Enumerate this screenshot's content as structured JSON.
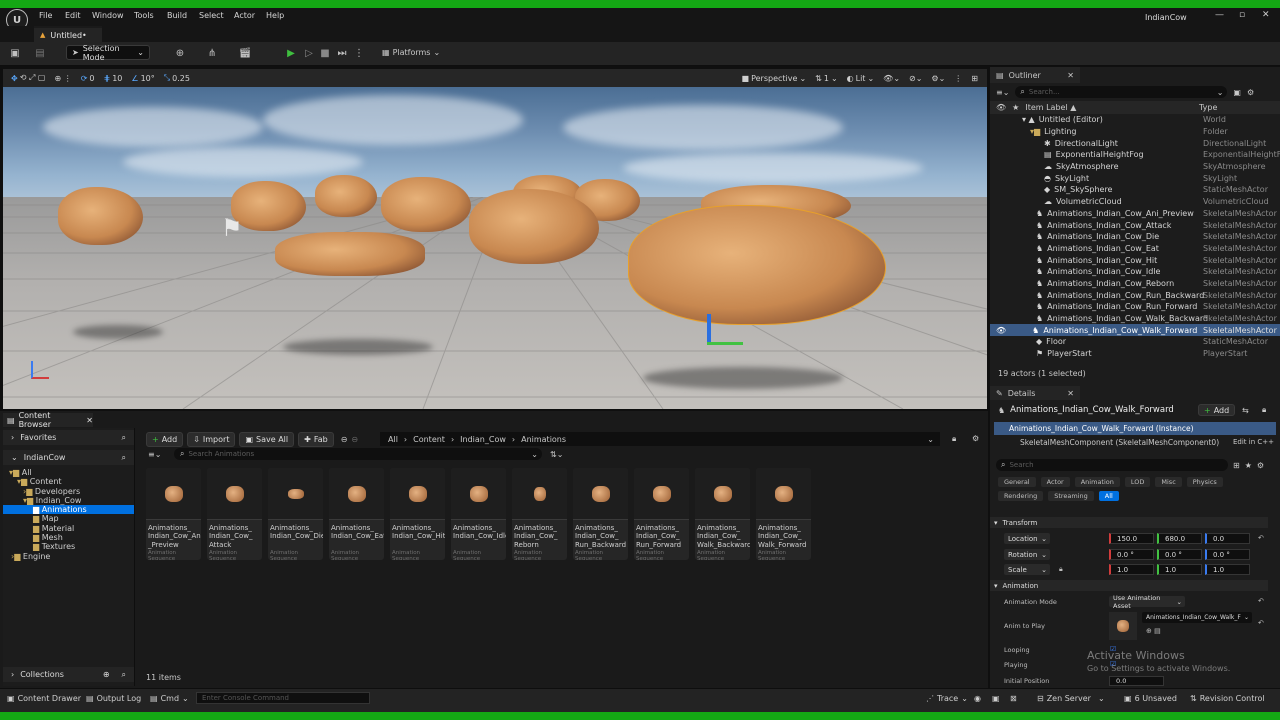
{
  "window": {
    "title": "IndianCow",
    "doc_tab": "Untitled•"
  },
  "menu": [
    "File",
    "Edit",
    "Window",
    "Tools",
    "Build",
    "Select",
    "Actor",
    "Help"
  ],
  "toolbar": {
    "selection_mode": "Selection Mode",
    "platforms": "Platforms"
  },
  "viewport": {
    "grid_snap": "10",
    "rot_snap": "10°",
    "scale_snap": "0.25",
    "rot_value": "0",
    "perspective": "Perspective",
    "lit": "Lit",
    "layer": "1"
  },
  "content_browser": {
    "tab": "Content Browser",
    "favorites": "Favorites",
    "project": "IndianCow",
    "tree": [
      "All",
      "Content",
      "Developers",
      "Indian_Cow",
      "Animations",
      "Map",
      "Material",
      "Mesh",
      "Textures",
      "Engine"
    ],
    "collections": "Collections",
    "add": "Add",
    "import": "Import",
    "save_all": "Save All",
    "fab": "Fab",
    "breadcrumb": [
      "All",
      "Content",
      "Indian_Cow",
      "Animations"
    ],
    "search_placeholder": "Search Animations",
    "item_count": "11 items",
    "assets": [
      {
        "name": "Animations_ Indian_Cow_Ani _Preview",
        "type": "Animation Sequence"
      },
      {
        "name": "Animations_ Indian_Cow_ Attack",
        "type": "Animation Sequence"
      },
      {
        "name": "Animations_ Indian_Cow_Die",
        "type": "Animation Sequence"
      },
      {
        "name": "Animations_ Indian_Cow_Eat",
        "type": "Animation Sequence"
      },
      {
        "name": "Animations_ Indian_Cow_Hit",
        "type": "Animation Sequence"
      },
      {
        "name": "Animations_ Indian_Cow_Idle",
        "type": "Animation Sequence"
      },
      {
        "name": "Animations_ Indian_Cow_ Reborn",
        "type": "Animation Sequence"
      },
      {
        "name": "Animations_ Indian_Cow_ Run_Backward",
        "type": "Animation Sequence"
      },
      {
        "name": "Animations_ Indian_Cow_ Run_Forward",
        "type": "Animation Sequence"
      },
      {
        "name": "Animations_ Indian_Cow_ Walk_Backward",
        "type": "Animation Sequence"
      },
      {
        "name": "Animations_ Indian_Cow_ Walk_Forward",
        "type": "Animation Sequence"
      }
    ]
  },
  "outliner": {
    "tab": "Outliner",
    "search_placeholder": "Search...",
    "col_label": "Item Label ▲",
    "col_type": "Type",
    "rows": [
      {
        "label": "Untitled (Editor)",
        "type": "World"
      },
      {
        "label": "Lighting",
        "type": "Folder"
      },
      {
        "label": "DirectionalLight",
        "type": "DirectionalLight"
      },
      {
        "label": "ExponentialHeightFog",
        "type": "ExponentialHeightF"
      },
      {
        "label": "SkyAtmosphere",
        "type": "SkyAtmosphere"
      },
      {
        "label": "SkyLight",
        "type": "SkyLight"
      },
      {
        "label": "SM_SkySphere",
        "type": "StaticMeshActor"
      },
      {
        "label": "VolumetricCloud",
        "type": "VolumetricCloud"
      },
      {
        "label": "Animations_Indian_Cow_Ani_Preview",
        "type": "SkeletalMeshActor"
      },
      {
        "label": "Animations_Indian_Cow_Attack",
        "type": "SkeletalMeshActor"
      },
      {
        "label": "Animations_Indian_Cow_Die",
        "type": "SkeletalMeshActor"
      },
      {
        "label": "Animations_Indian_Cow_Eat",
        "type": "SkeletalMeshActor"
      },
      {
        "label": "Animations_Indian_Cow_Hit",
        "type": "SkeletalMeshActor"
      },
      {
        "label": "Animations_Indian_Cow_Idle",
        "type": "SkeletalMeshActor"
      },
      {
        "label": "Animations_Indian_Cow_Reborn",
        "type": "SkeletalMeshActor"
      },
      {
        "label": "Animations_Indian_Cow_Run_Backward",
        "type": "SkeletalMeshActor"
      },
      {
        "label": "Animations_Indian_Cow_Run_Forward",
        "type": "SkeletalMeshActor"
      },
      {
        "label": "Animations_Indian_Cow_Walk_Backward",
        "type": "SkeletalMeshActor"
      },
      {
        "label": "Animations_Indian_Cow_Walk_Forward",
        "type": "SkeletalMeshActor"
      },
      {
        "label": "Floor",
        "type": "StaticMeshActor"
      },
      {
        "label": "PlayerStart",
        "type": "PlayerStart"
      }
    ],
    "footer": "19 actors (1 selected)"
  },
  "details": {
    "tab": "Details",
    "actor": "Animations_Indian_Cow_Walk_Forward",
    "add": "Add",
    "instance": "Animations_Indian_Cow_Walk_Forward (Instance)",
    "component": "SkeletalMeshComponent (SkeletalMeshComponent0)",
    "edit_cpp": "Edit in C++",
    "search_placeholder": "Search",
    "filters1": [
      "General",
      "Actor",
      "Animation",
      "LOD",
      "Misc",
      "Physics"
    ],
    "filters2": [
      "Rendering",
      "Streaming",
      "All"
    ],
    "transform": "Transform",
    "location": {
      "label": "Location",
      "x": "150.0",
      "y": "680.0",
      "z": "0.0"
    },
    "rotation": {
      "label": "Rotation",
      "x": "0.0 °",
      "y": "0.0 °",
      "z": "0.0 °"
    },
    "scale": {
      "label": "Scale",
      "x": "1.0",
      "y": "1.0",
      "z": "1.0"
    },
    "animation": "Animation",
    "anim_mode_label": "Animation Mode",
    "anim_mode": "Use Animation Asset",
    "anim_to_play_label": "Anim to Play",
    "anim_to_play": "Animations_Indian_Cow_Walk_F",
    "looping": "Looping",
    "playing": "Playing",
    "initial_position": "Initial Position",
    "initial_value": "0.0",
    "watermark1": "Activate Windows",
    "watermark2": "Go to Settings to activate Windows."
  },
  "status": {
    "drawer": "Content Drawer",
    "output": "Output Log",
    "cmd": "Cmd",
    "console_placeholder": "Enter Console Command",
    "trace": "Trace",
    "zen": "Zen Server",
    "unsaved": "6 Unsaved",
    "revision": "Revision Control"
  },
  "colors": {
    "accent": "#0070e0",
    "selected": "#3a5a86",
    "green_border": "#14a814"
  }
}
